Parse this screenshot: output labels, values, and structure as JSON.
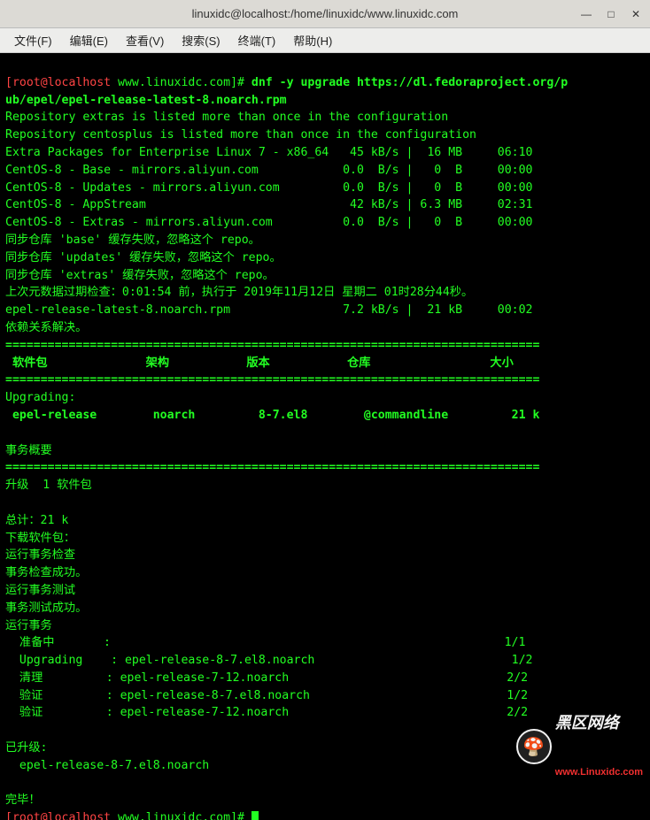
{
  "window": {
    "title": "linuxidc@localhost:/home/linuxidc/www.linuxidc.com"
  },
  "menu": {
    "file": "文件(F)",
    "edit": "编辑(E)",
    "view": "查看(V)",
    "search": "搜索(S)",
    "terminal": "终端(T)",
    "help": "帮助(H)"
  },
  "prompt": {
    "user": "[root@localhost",
    "cwd": " www.linuxidc.com]# ",
    "cmd": "dnf -y upgrade https://dl.fedoraproject.org/p",
    "cmd2": "ub/epel/epel-release-latest-8.noarch.rpm"
  },
  "output": {
    "repo_extras": "Repository extras is listed more than once in the configuration",
    "repo_centosplus": "Repository centosplus is listed more than once in the configuration",
    "pkg_line1": "Extra Packages for Enterprise Linux 7 - x86_64   45 kB/s |  16 MB     06:10",
    "pkg_line2": "CentOS-8 - Base - mirrors.aliyun.com            0.0  B/s |   0  B     00:00",
    "pkg_line3": "CentOS-8 - Updates - mirrors.aliyun.com         0.0  B/s |   0  B     00:00",
    "pkg_line4": "CentOS-8 - AppStream                             42 kB/s | 6.3 MB     02:31",
    "pkg_line5": "CentOS-8 - Extras - mirrors.aliyun.com          0.0  B/s |   0  B     00:00",
    "sync1": "同步仓库 'base' 缓存失败，忽略这个 repo。",
    "sync2": "同步仓库 'updates' 缓存失败，忽略这个 repo。",
    "sync3": "同步仓库 'extras' 缓存失败，忽略这个 repo。",
    "meta_check": "上次元数据过期检查：0:01:54 前，执行于 2019年11月12日 星期二 01时28分44秒。",
    "rpm_dl": "epel-release-latest-8.noarch.rpm                7.2 kB/s |  21 kB     00:02",
    "dep_solve": "依赖关系解决。",
    "sep": "============================================================================",
    "header": " 软件包              架构           版本           仓库                 大小",
    "upgrading_label": "Upgrading:",
    "upgrading_row": " epel-release        noarch         8-7.el8        @commandline         21 k",
    "summary_label": "事务概要",
    "upgrade_count": "升级  1 软件包",
    "total": "总计：21 k",
    "download_label": "下载软件包：",
    "trans_check": "运行事务检查",
    "trans_check_ok": "事务检查成功。",
    "trans_test": "运行事务测试",
    "trans_test_ok": "事务测试成功。",
    "trans_run": "运行事务",
    "prep": "  准备中       :                                                        1/1",
    "upg": "  Upgrading    : epel-release-8-7.el8.noarch                            1/2",
    "clean": "  清理         : epel-release-7-12.noarch                               2/2",
    "verify1": "  验证         : epel-release-8-7.el8.noarch                            1/2",
    "verify2": "  验证         : epel-release-7-12.noarch                               2/2",
    "upgraded_label": "已升级:",
    "upgraded_pkg": "  epel-release-8-7.el8.noarch",
    "done": "完毕！"
  },
  "watermark": {
    "cn": "黑区网络",
    "sub": "www.Linuxidc.com"
  }
}
